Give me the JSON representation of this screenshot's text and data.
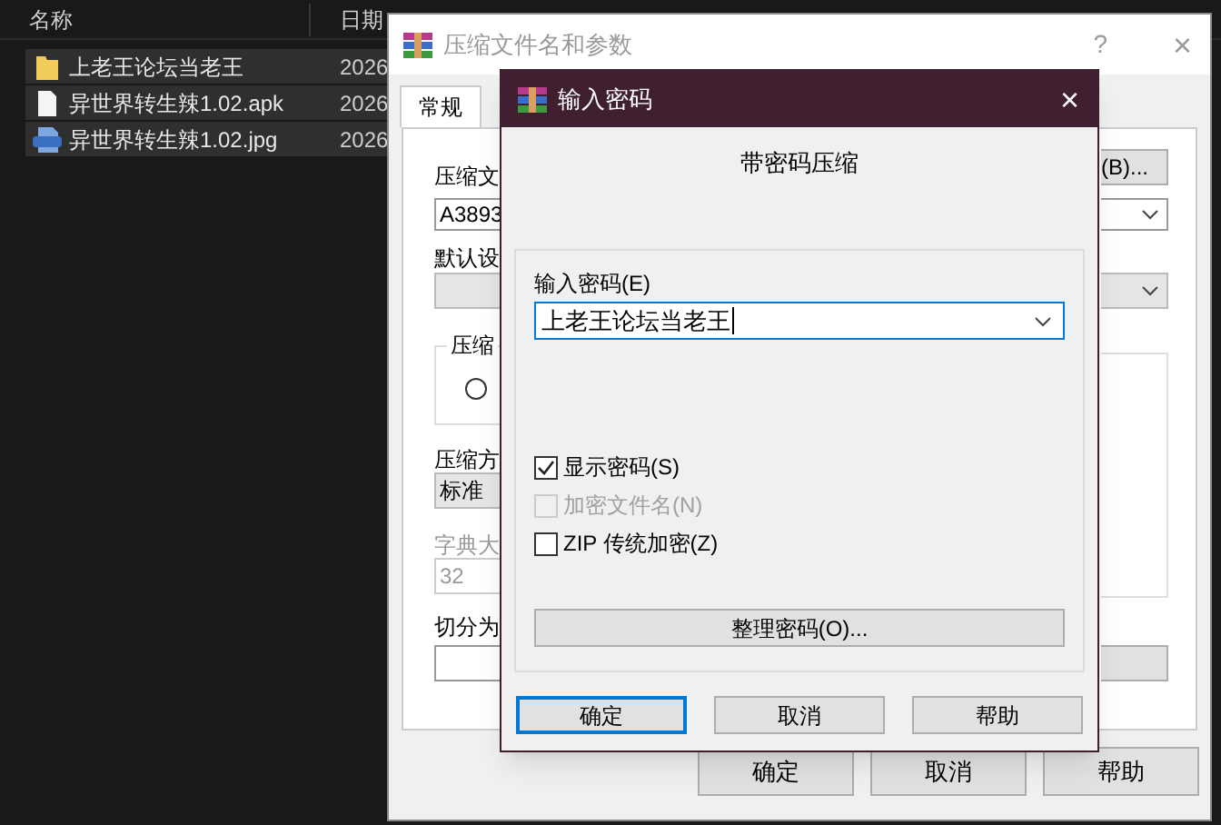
{
  "explorer": {
    "columns": [
      "名称",
      "日期"
    ],
    "files": [
      {
        "name": "上老王论坛当老王",
        "kind": "folder",
        "date": "2026",
        "selected": true
      },
      {
        "name": "异世界转生辣1.02.apk",
        "kind": "file",
        "date": "2026",
        "selected": true
      },
      {
        "name": "异世界转生辣1.02.jpg",
        "kind": "image",
        "date": "2026",
        "selected": true
      }
    ]
  },
  "archive_dialog": {
    "title": "压缩文件名和参数",
    "help": "?",
    "close": "×",
    "tabs": [
      {
        "label": "常规",
        "selected": true
      }
    ],
    "left": {
      "name_label": "压缩文",
      "name_value": "A3893",
      "profile_label": "默认设",
      "group_label": "压缩",
      "radio": {
        "selected": false
      },
      "method_label": "压缩方",
      "method_value": "标准",
      "dict_label": "字典大",
      "dict_value": "32",
      "split_label": "切分为"
    },
    "browse_button": "(B)...",
    "buttons": [
      "确定",
      "取消",
      "帮助"
    ]
  },
  "password_dialog": {
    "title": "输入密码",
    "close": "×",
    "heading": "带密码压缩",
    "field_label": "输入密码(E)",
    "password": "上老王论坛当老王",
    "checkboxes": [
      {
        "label": "显示密码(S)",
        "checked": true,
        "disabled": false
      },
      {
        "label": "加密文件名(N)",
        "checked": false,
        "disabled": true
      },
      {
        "label": "ZIP 传统加密(Z)",
        "checked": false,
        "disabled": false
      }
    ],
    "organize_button": "整理密码(O)...",
    "buttons": [
      {
        "label": "确定",
        "focused": true
      },
      {
        "label": "取消",
        "focused": false
      },
      {
        "label": "帮助",
        "focused": false
      }
    ]
  }
}
